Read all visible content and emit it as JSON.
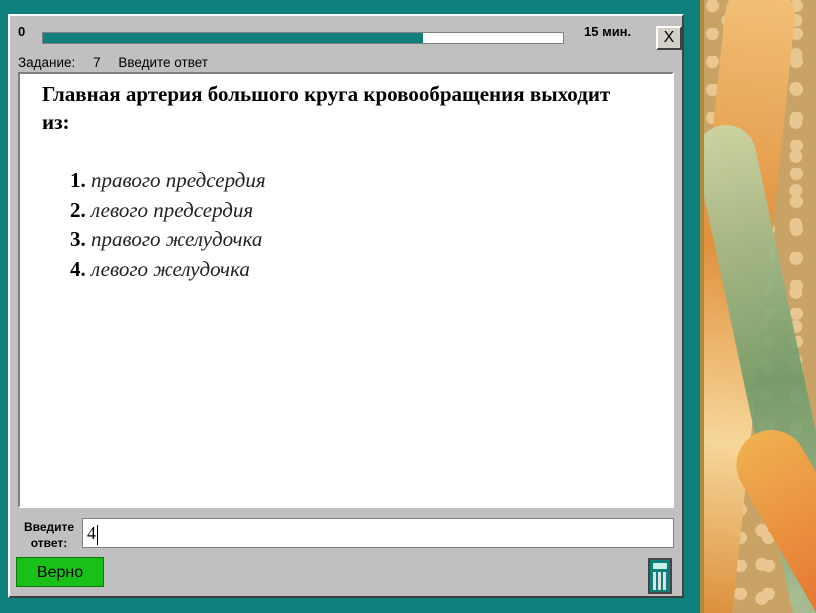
{
  "header": {
    "progress_start": "0",
    "timer_label": "15 мин.",
    "progress_fraction": 0.73,
    "close_label": "X"
  },
  "task": {
    "label": "Задание:",
    "number": "7",
    "instruction": "Введите ответ"
  },
  "question": {
    "text": "Главная артерия большого круга кровообращения выходит из:",
    "options": [
      {
        "num": "1.",
        "text": "правого предсердия"
      },
      {
        "num": "2.",
        "text": "левого предсердия"
      },
      {
        "num": "3.",
        "text": "правого желудочка"
      },
      {
        "num": "4.",
        "text": "левого желудочка"
      }
    ]
  },
  "answer": {
    "label_line1": "Введите",
    "label_line2": "ответ:",
    "value": "4"
  },
  "result": {
    "label": "Верно",
    "color": "#18c018"
  },
  "icons": {
    "calculator": "calculator-icon"
  }
}
